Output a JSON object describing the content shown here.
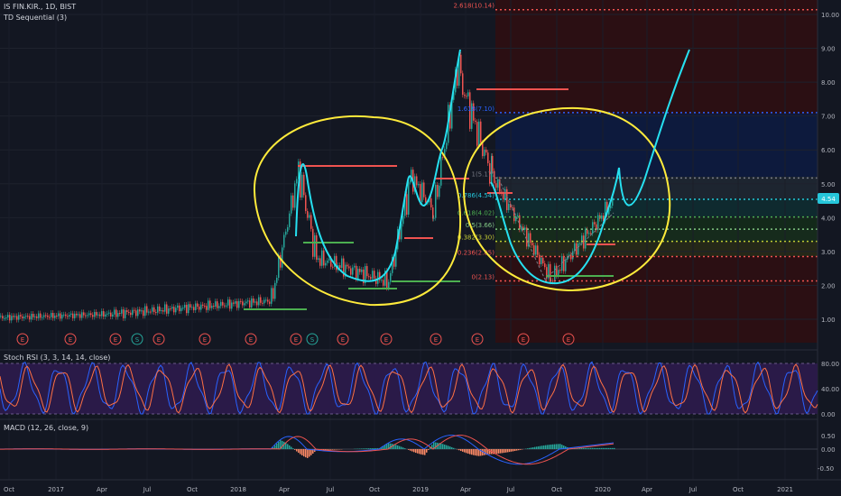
{
  "header": {
    "symbol": "IS FIN.KIR., 1D, BIST",
    "indicator": "TD Sequential (3)"
  },
  "stoch": {
    "label": "Stoch RSI (3, 3, 14, 14, close)",
    "ticks": [
      "80.00",
      "40.00",
      "0.00"
    ]
  },
  "macd": {
    "label": "MACD (12, 26, close, 9)",
    "ticks": [
      "0.50",
      "0.00",
      "-0.50"
    ]
  },
  "price_axis": {
    "ticks": [
      "10.00",
      "9.00",
      "8.00",
      "7.00",
      "6.00",
      "5.00",
      "4.00",
      "3.00",
      "2.00",
      "1.00"
    ],
    "current_price": "4.54"
  },
  "time_axis": {
    "labels": [
      "Oct",
      "2017",
      "Apr",
      "Jul",
      "Oct",
      "2018",
      "Apr",
      "Jul",
      "Oct",
      "2019",
      "Apr",
      "Jul",
      "Oct",
      "2020",
      "Apr",
      "Jul",
      "Oct",
      "2021"
    ]
  },
  "fib": {
    "levels": [
      {
        "label": "2.618(10.14)",
        "price": 10.14,
        "color": "#ef5350"
      },
      {
        "label": "1.618(7.10)",
        "price": 7.1,
        "color": "#2962ff"
      },
      {
        "label": "1(5.17)",
        "price": 5.17,
        "color": "#787b86"
      },
      {
        "label": "0.786(4.54)",
        "price": 4.54,
        "color": "#26c6da"
      },
      {
        "label": "0.618(4.02)",
        "price": 4.02,
        "color": "#4caf50"
      },
      {
        "label": "0.5(3.66)",
        "price": 3.66,
        "color": "#81c784"
      },
      {
        "label": "0.382(3.30)",
        "price": 3.3,
        "color": "#c0ca33"
      },
      {
        "label": "0.236(2.85)",
        "price": 2.85,
        "color": "#ef5350"
      },
      {
        "label": "0(2.13)",
        "price": 2.13,
        "color": "#ef5350"
      }
    ]
  },
  "events": [
    {
      "label": "E",
      "kind": "earnings"
    },
    {
      "label": "E",
      "kind": "earnings"
    },
    {
      "label": "E",
      "kind": "earnings"
    },
    {
      "label": "S",
      "kind": "split"
    },
    {
      "label": "E",
      "kind": "earnings"
    },
    {
      "label": "E",
      "kind": "earnings"
    },
    {
      "label": "E",
      "kind": "earnings"
    },
    {
      "label": "E",
      "kind": "earnings"
    },
    {
      "label": "S",
      "kind": "split"
    },
    {
      "label": "E",
      "kind": "earnings"
    },
    {
      "label": "E",
      "kind": "earnings"
    },
    {
      "label": "E",
      "kind": "earnings"
    },
    {
      "label": "E",
      "kind": "earnings"
    },
    {
      "label": "E",
      "kind": "earnings"
    },
    {
      "label": "E",
      "kind": "earnings"
    }
  ],
  "colors": {
    "background": "#131722",
    "annotation_cyan": "#26e0f0",
    "annotation_yellow": "#ffeb3b",
    "candle_up": "#26a69a",
    "candle_down": "#ef5350",
    "stoch_band": "#3b1f5e",
    "macd_line": "#2962ff",
    "signal_line": "#ef5350"
  }
}
